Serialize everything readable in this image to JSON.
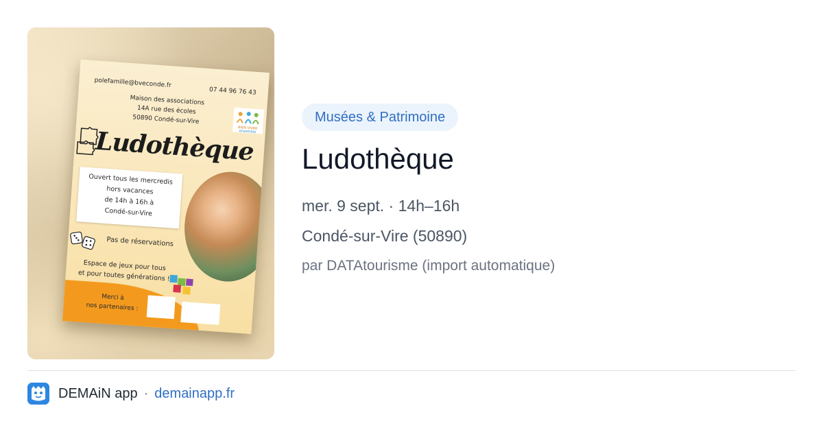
{
  "card": {
    "category": "Musées & Patrimoine",
    "title": "Ludothèque",
    "date_time": "mer. 9 sept. · 14h–16h",
    "location": "Condé-sur-Vire (50890)",
    "source": "par DATAtourisme (import automatique)"
  },
  "poster": {
    "email": "polefamille@bveconde.fr",
    "phone": "07 44 96 76 43",
    "address_lines": [
      "Maison des associations",
      "14A rue des écoles",
      "50890 Condé-sur-Vire"
    ],
    "title": "Ludothèque",
    "hours_lines": [
      "Ouvert tous les mercredis",
      "hors vacances",
      "de 14h à 16h à",
      "Condé-sur-Vire"
    ],
    "no_booking": "Pas de réservations",
    "space_lines": [
      "Espace de jeux pour tous",
      "et pour toutes générations !"
    ],
    "thanks_lines": [
      "Merci à",
      "nos partenaires :"
    ],
    "logo_text": "BIEN VIVRE ensemble"
  },
  "footer": {
    "app_name": "DEMAiN app",
    "separator": "·",
    "domain": "demainapp.fr",
    "icon": "demain-app-icon"
  },
  "colors": {
    "accent": "#2f6fc2",
    "chip_bg": "#ebf3fc",
    "poster_orange": "#f39a1e"
  }
}
